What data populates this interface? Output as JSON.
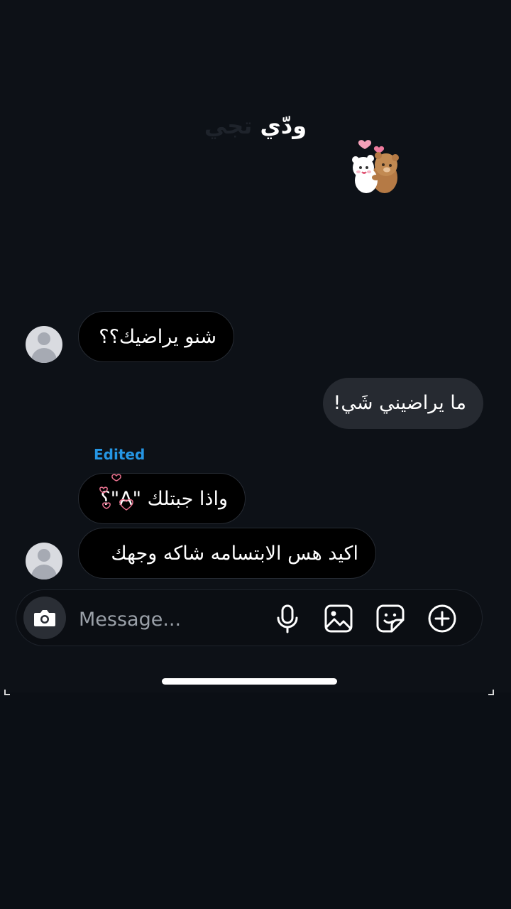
{
  "overlay": {
    "caption_part1": "ودّي",
    "caption_part2": "تجي"
  },
  "chat": {
    "messages": [
      {
        "direction": "incoming",
        "text": "شنو يراضيك؟؟"
      },
      {
        "direction": "outgoing",
        "text": "ما يراضيني شَي!"
      },
      {
        "direction": "incoming",
        "text": "واذا جبتلك \"A\"؟",
        "edited_label": "Edited"
      },
      {
        "direction": "incoming",
        "text": "اكيد هس الابتسامه شاكه وجهك"
      }
    ]
  },
  "composer": {
    "placeholder": "Message..."
  },
  "icons": {
    "camera": "camera-icon",
    "mic": "microphone-icon",
    "gallery": "gallery-icon",
    "sticker": "sticker-icon",
    "add": "plus-circle-icon"
  },
  "colors": {
    "edited": "#2596e4",
    "outgoing_bubble": "#262a31",
    "incoming_bubble": "#000000",
    "background": "#0d1117"
  }
}
